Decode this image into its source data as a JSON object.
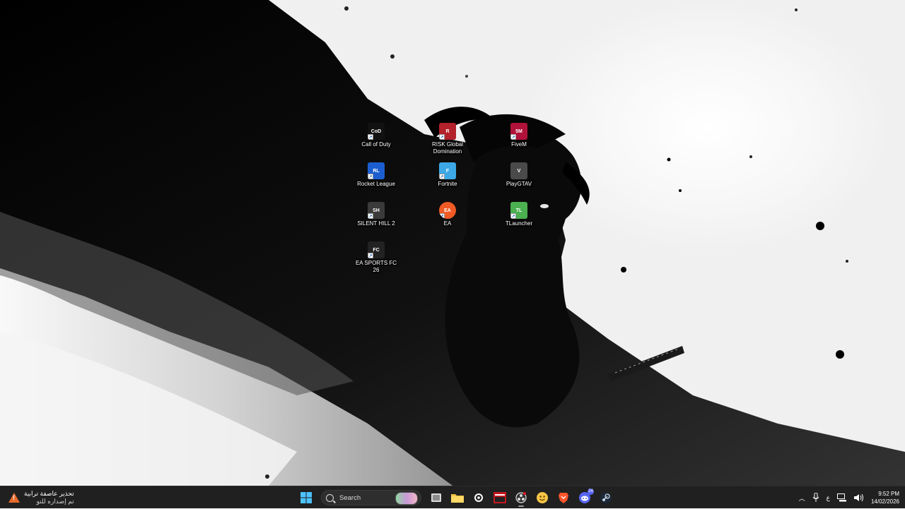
{
  "desktop": {
    "icons": [
      {
        "label": "Call of Duty",
        "icon": "call-of-duty-icon",
        "color": "#111111"
      },
      {
        "label": "Rocket League",
        "icon": "rocket-league-icon",
        "color": "#1c5ecf"
      },
      {
        "label": "SILENT HILL 2",
        "icon": "silent-hill-icon",
        "color": "#3a3a3a"
      },
      {
        "label": "EA SPORTS FC 26",
        "icon": "ea-sports-fc-icon",
        "color": "#222222"
      },
      {
        "label": "RISK Global Domination",
        "icon": "risk-icon",
        "color": "#b3212b"
      },
      {
        "label": "Fortnite",
        "icon": "fortnite-icon",
        "color": "#3ca8e6"
      },
      {
        "label": "EA",
        "icon": "ea-icon",
        "color": "#f05a24"
      },
      {
        "label": "FiveM",
        "icon": "fivem-icon",
        "color": "#b1123a"
      },
      {
        "label": "PlayGTAV",
        "icon": "gta-icon",
        "color": "#4a4a4a"
      },
      {
        "label": "TLauncher",
        "icon": "tlauncher-icon",
        "color": "#4caf50"
      }
    ]
  },
  "taskbar": {
    "weather": {
      "title": "تحذير عاصفة ترابية",
      "subtitle": "تم إصداره للتو",
      "icon": "warning-icon"
    },
    "search_placeholder": "Search",
    "apps": [
      {
        "name": "start-icon"
      },
      {
        "name": "task-view-icon"
      },
      {
        "name": "file-explorer-icon"
      },
      {
        "name": "steelseries-icon"
      },
      {
        "name": "news-app-icon"
      },
      {
        "name": "obs-icon"
      },
      {
        "name": "emoji-app-icon"
      },
      {
        "name": "brave-icon"
      },
      {
        "name": "discord-icon",
        "badge": "24"
      },
      {
        "name": "steam-icon"
      }
    ],
    "tray": {
      "language": "ع",
      "time": "9:52 PM",
      "date": "14/02/2026"
    }
  }
}
